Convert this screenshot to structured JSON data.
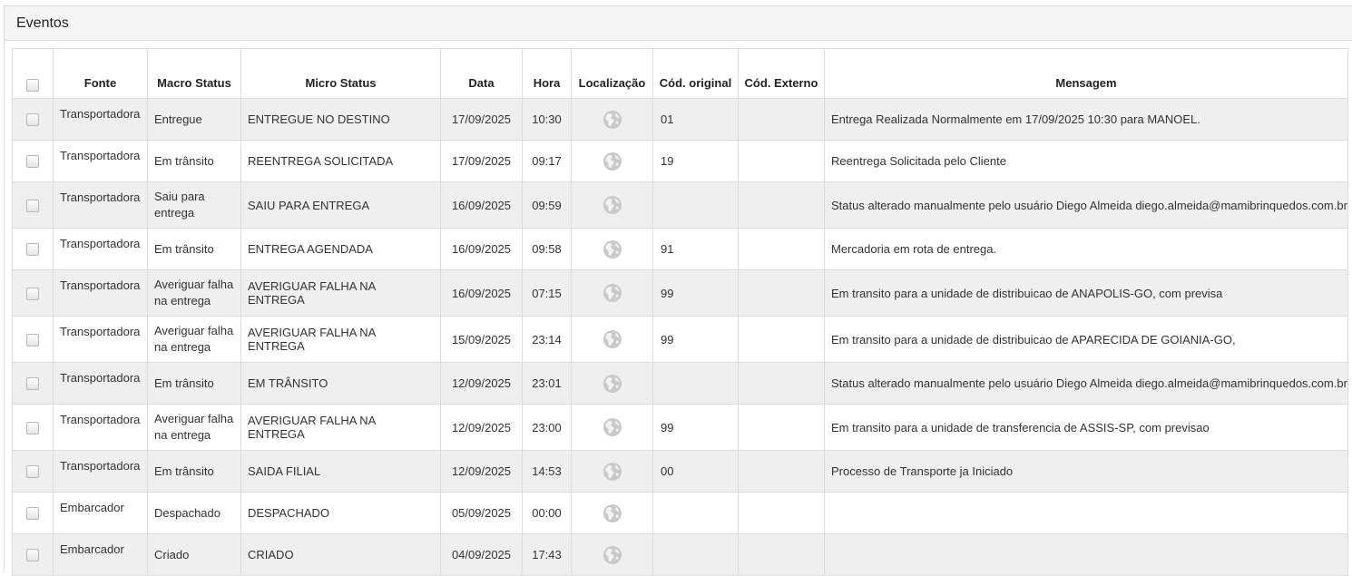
{
  "panel": {
    "title": "Eventos"
  },
  "table": {
    "headers": {
      "fonte": "Fonte",
      "macro": "Macro Status",
      "micro": "Micro Status",
      "data": "Data",
      "hora": "Hora",
      "localizacao": "Localização",
      "cod_original": "Cód. original",
      "cod_externo": "Cód. Externo",
      "mensagem": "Mensagem"
    },
    "location_icon": "globe-icon",
    "rows": [
      {
        "fonte": "Transportadora",
        "macro": "Entregue",
        "micro": "ENTREGUE NO DESTINO",
        "data": "17/09/2025",
        "hora": "10:30",
        "cod_original": "01",
        "cod_externo": "",
        "mensagem": "Entrega Realizada Normalmente em 17/09/2025 10:30 para MANOEL."
      },
      {
        "fonte": "Transportadora",
        "macro": "Em trânsito",
        "micro": "REENTREGA SOLICITADA",
        "data": "17/09/2025",
        "hora": "09:17",
        "cod_original": "19",
        "cod_externo": "",
        "mensagem": "Reentrega Solicitada pelo Cliente"
      },
      {
        "fonte": "Transportadora",
        "macro": "Saiu para entrega",
        "micro": "SAIU PARA ENTREGA",
        "data": "16/09/2025",
        "hora": "09:59",
        "cod_original": "",
        "cod_externo": "",
        "mensagem": "Status alterado manualmente pelo usuário Diego Almeida diego.almeida@mamibrinquedos.com.br"
      },
      {
        "fonte": "Transportadora",
        "macro": "Em trânsito",
        "micro": "ENTREGA AGENDADA",
        "data": "16/09/2025",
        "hora": "09:58",
        "cod_original": "91",
        "cod_externo": "",
        "mensagem": "Mercadoria em rota de entrega."
      },
      {
        "fonte": "Transportadora",
        "macro": "Averiguar falha na entrega",
        "micro": "AVERIGUAR FALHA NA ENTREGA",
        "data": "16/09/2025",
        "hora": "07:15",
        "cod_original": "99",
        "cod_externo": "",
        "mensagem": "Em transito para a unidade de distribuicao de ANAPOLIS-GO, com previsa"
      },
      {
        "fonte": "Transportadora",
        "macro": "Averiguar falha na entrega",
        "micro": "AVERIGUAR FALHA NA ENTREGA",
        "data": "15/09/2025",
        "hora": "23:14",
        "cod_original": "99",
        "cod_externo": "",
        "mensagem": "Em transito para a unidade de distribuicao de APARECIDA DE GOIANIA-GO,"
      },
      {
        "fonte": "Transportadora",
        "macro": "Em trânsito",
        "micro": "EM TRÂNSITO",
        "data": "12/09/2025",
        "hora": "23:01",
        "cod_original": "",
        "cod_externo": "",
        "mensagem": "Status alterado manualmente pelo usuário Diego Almeida diego.almeida@mamibrinquedos.com.br"
      },
      {
        "fonte": "Transportadora",
        "macro": "Averiguar falha na entrega",
        "micro": "AVERIGUAR FALHA NA ENTREGA",
        "data": "12/09/2025",
        "hora": "23:00",
        "cod_original": "99",
        "cod_externo": "",
        "mensagem": "Em transito para a unidade de transferencia de ASSIS-SP, com previsao"
      },
      {
        "fonte": "Transportadora",
        "macro": "Em trânsito",
        "micro": "SAIDA FILIAL",
        "data": "12/09/2025",
        "hora": "14:53",
        "cod_original": "00",
        "cod_externo": "",
        "mensagem": "Processo de Transporte ja Iniciado"
      },
      {
        "fonte": "Embarcador",
        "macro": "Despachado",
        "micro": "DESPACHADO",
        "data": "05/09/2025",
        "hora": "00:00",
        "cod_original": "",
        "cod_externo": "",
        "mensagem": ""
      },
      {
        "fonte": "Embarcador",
        "macro": "Criado",
        "micro": "CRIADO",
        "data": "04/09/2025",
        "hora": "17:43",
        "cod_original": "",
        "cod_externo": "",
        "mensagem": ""
      }
    ]
  }
}
